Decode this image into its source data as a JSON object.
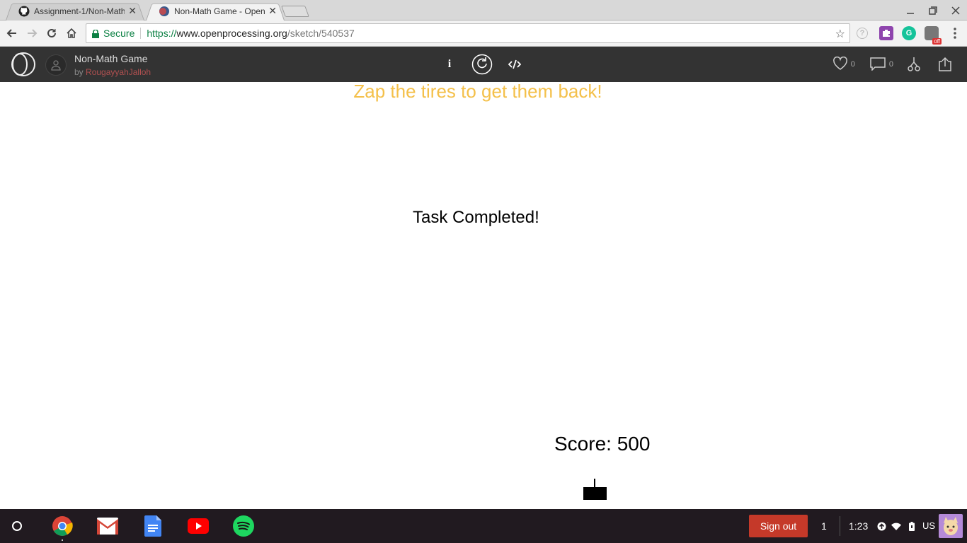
{
  "browser": {
    "tabs": [
      {
        "title": "Assignment-1/Non-Math",
        "icon": "github-icon",
        "active": false
      },
      {
        "title": "Non-Math Game - OpenP",
        "icon": "openprocessing-icon",
        "active": true
      }
    ],
    "address": {
      "secure_label": "Secure",
      "scheme": "https://",
      "host": "www.openprocessing.org",
      "path": "/sketch/540537"
    },
    "extension_badge": "off"
  },
  "sketch_header": {
    "title": "Non-Math Game",
    "by_prefix": "by",
    "author": "RougayyahJalloh",
    "info_label": "i",
    "like_count": "0",
    "comment_count": "0"
  },
  "canvas": {
    "instruction": "Zap the tires to get them back!",
    "status": "Task Completed!",
    "score": "Score: 500",
    "colors": {
      "instruction": "#f4c04a"
    }
  },
  "shelf": {
    "apps": [
      "chrome-icon",
      "gmail-icon",
      "docs-icon",
      "youtube-icon",
      "spotify-icon"
    ],
    "sign_out": "Sign out",
    "notification_count": "1",
    "time": "1:23",
    "locale": "US",
    "colors": {
      "sign_out": "#c53929",
      "shelf_bg": "#211a20"
    }
  }
}
